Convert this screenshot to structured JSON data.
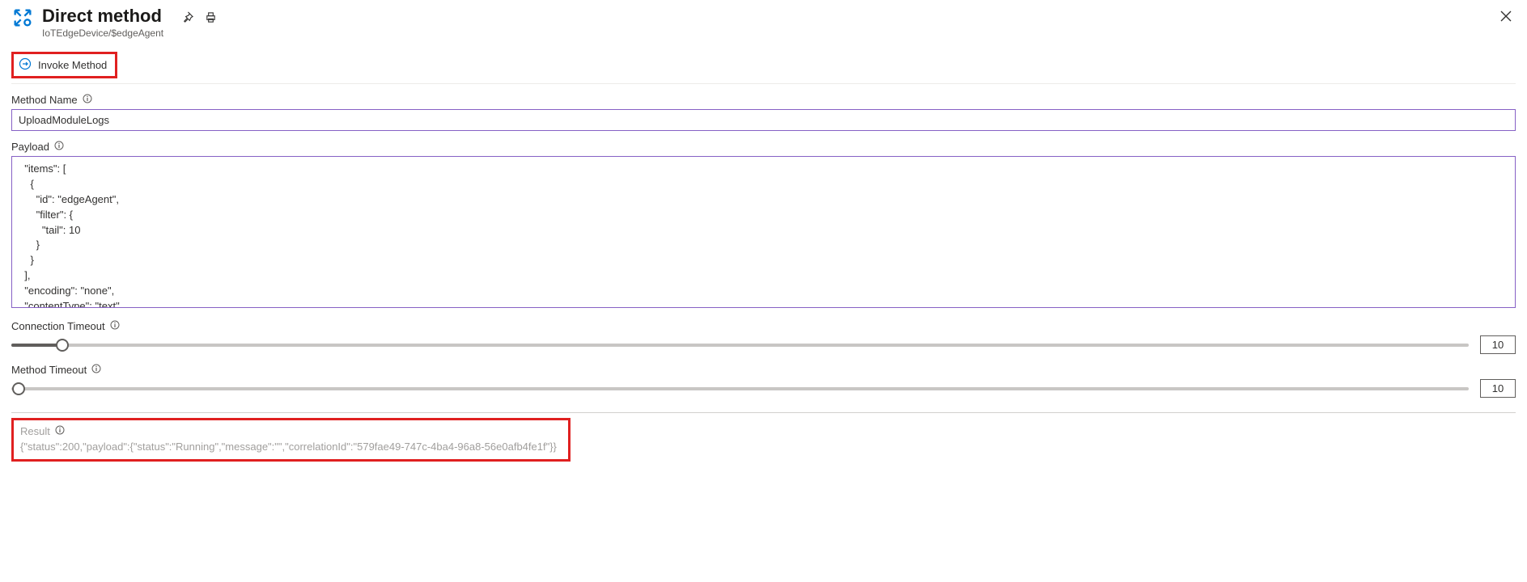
{
  "header": {
    "title": "Direct method",
    "subtitle": "IoTEdgeDevice/$edgeAgent"
  },
  "toolbar": {
    "invoke_label": "Invoke Method"
  },
  "fields": {
    "method_name_label": "Method Name",
    "method_name_value": "UploadModuleLogs",
    "payload_label": "Payload",
    "payload_value": "  \"items\": [\n    {\n      \"id\": \"edgeAgent\",\n      \"filter\": {\n        \"tail\": 10\n      }\n    }\n  ],\n  \"encoding\": \"none\",\n  \"contentType\": \"text\"",
    "connection_timeout_label": "Connection Timeout",
    "connection_timeout_value": "10",
    "method_timeout_label": "Method Timeout",
    "method_timeout_value": "10"
  },
  "sliders": {
    "connection_fill_percent": 3.5,
    "method_fill_percent": 0
  },
  "result": {
    "label": "Result",
    "text": "{\"status\":200,\"payload\":{\"status\":\"Running\",\"message\":\"\",\"correlationId\":\"579fae49-747c-4ba4-96a8-56e0afb4fe1f\"}}"
  }
}
